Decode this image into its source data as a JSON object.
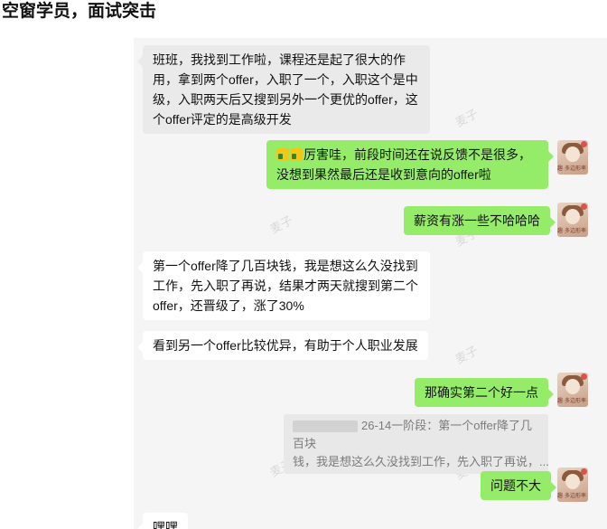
{
  "page": {
    "title": "空窗学员，面试突击"
  },
  "watermark": "麦子",
  "messages": [
    {
      "side": "left",
      "text": "班班，我找到工作啦，课程还是起了很大的作用，拿到两个offer，入职了一个，入职这个是中级，入职两天后又搜到另外一个更优的offer，这个offer评定的是高级开发"
    },
    {
      "side": "right",
      "emoji": "thumbs-up-icon",
      "text": "厉害哇，前段时间还在说反馈不是很多，没想到果然最后还是收到意向的offer啦"
    },
    {
      "side": "right",
      "text": "薪资有涨一些不哈哈哈"
    },
    {
      "side": "left",
      "text": "第一个offer降了几百块钱，我是想这么久没找到工作，先入职了再说，结果才两天就搜到第二个offer，还晋级了，涨了30%"
    },
    {
      "side": "left",
      "text": "看到另一个offer比较优异，有助于个人职业发展"
    },
    {
      "side": "right",
      "text": "那确实第二个好一点"
    },
    {
      "side": "right",
      "text": "问题不大"
    },
    {
      "side": "left",
      "text": "嘿嘿"
    }
  ],
  "quote": {
    "line1": "26-14一阶段：第一个offer降了几百块",
    "line2": "钱，我是想这么久没找到工作，先入职了再说，..."
  },
  "avatar_caption": "趣·多边形率 97"
}
